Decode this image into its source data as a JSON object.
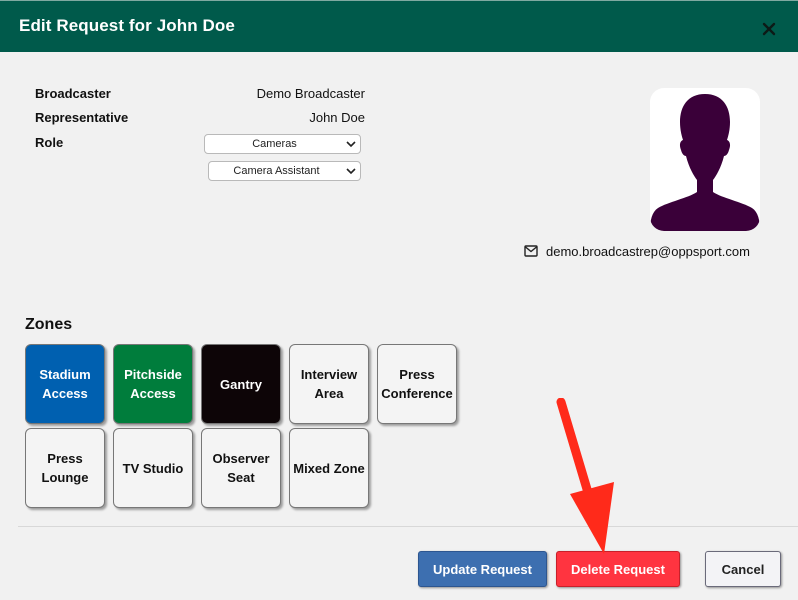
{
  "modal": {
    "title": "Edit Request for John Doe",
    "close_icon": "close-icon"
  },
  "info": {
    "broadcaster_label": "Broadcaster",
    "broadcaster_value": "Demo Broadcaster",
    "representative_label": "Representative",
    "representative_value": "John Doe",
    "role_label": "Role",
    "role_select": "Cameras",
    "sub_role_select": "Camera Assistant"
  },
  "profile": {
    "avatar_icon": "person-silhouette-icon",
    "email": "demo.broadcastrep@oppsport.com",
    "email_icon": "mail-icon"
  },
  "zones": {
    "title": "Zones",
    "items": [
      {
        "label_lines": [
          "Stadium",
          "Access"
        ],
        "bg": "#0060b0",
        "fg": "#ffffff"
      },
      {
        "label_lines": [
          "Pitchside",
          "Access"
        ],
        "bg": "#007d3c",
        "fg": "#ffffff"
      },
      {
        "label_lines": [
          "Gantry"
        ],
        "bg": "#0d0507",
        "fg": "#ffffff"
      },
      {
        "label_lines": [
          "Interview",
          "Area"
        ],
        "bg": "#f4f4f4",
        "fg": "#111111"
      },
      {
        "label_lines": [
          "Press",
          "Conference"
        ],
        "bg": "#f4f4f4",
        "fg": "#111111"
      },
      {
        "label_lines": [
          "Press",
          "Lounge"
        ],
        "bg": "#f4f4f4",
        "fg": "#111111"
      },
      {
        "label_lines": [
          "TV Studio"
        ],
        "bg": "#f4f4f4",
        "fg": "#111111"
      },
      {
        "label_lines": [
          "Observer",
          "Seat"
        ],
        "bg": "#f4f4f4",
        "fg": "#111111"
      },
      {
        "label_lines": [
          "Mixed Zone"
        ],
        "bg": "#f4f4f4",
        "fg": "#111111"
      }
    ]
  },
  "footer": {
    "update_label": "Update Request",
    "delete_label": "Delete Request",
    "cancel_label": "Cancel"
  },
  "colors": {
    "header": "#005a4b",
    "update": "#3d6fb0",
    "delete": "#ff3440",
    "annotation_arrow": "#ff2a1a"
  }
}
